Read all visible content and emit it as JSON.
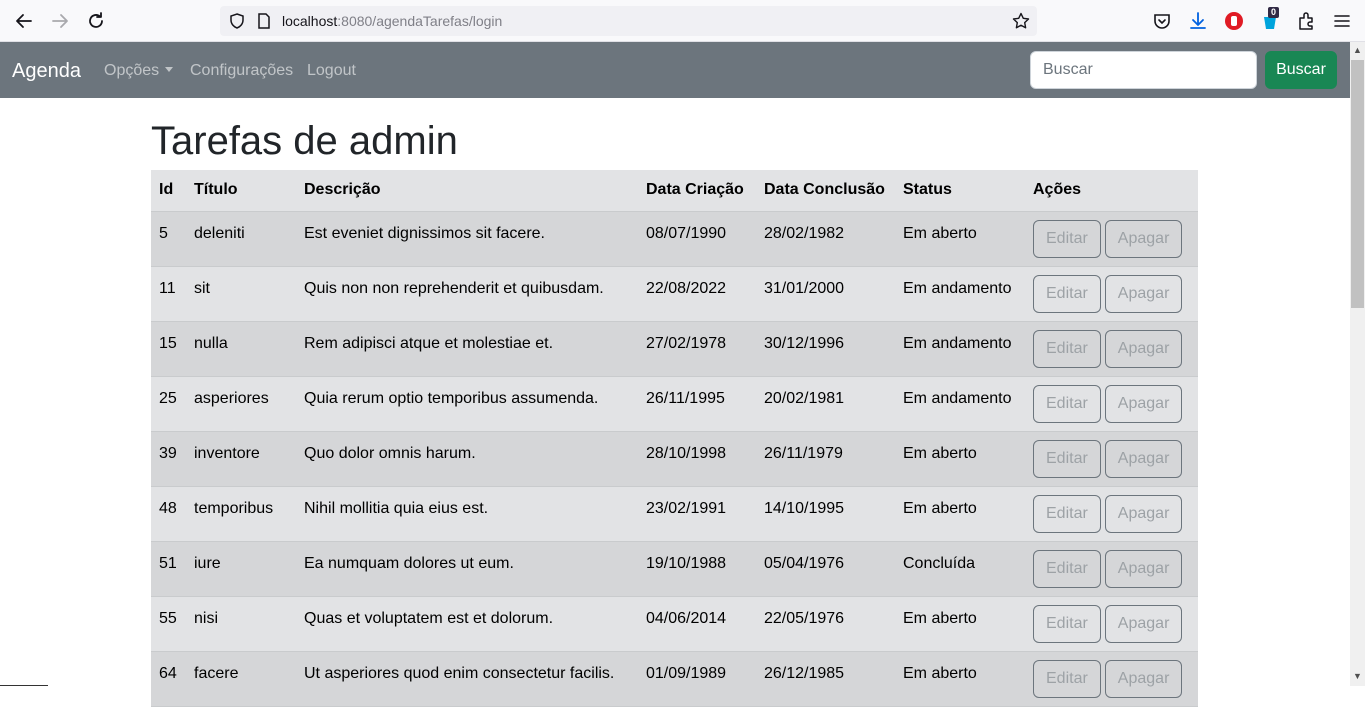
{
  "browser": {
    "url_host": "localhost",
    "url_rest": ":8080/agendaTarefas/login",
    "extension_badge": "0"
  },
  "navbar": {
    "brand": "Agenda",
    "links": [
      "Opções",
      "Configurações",
      "Logout"
    ],
    "search_placeholder": "Buscar",
    "search_button": "Buscar"
  },
  "page": {
    "title": "Tarefas de admin"
  },
  "table": {
    "headers": [
      "Id",
      "Título",
      "Descrição",
      "Data Criação",
      "Data Conclusão",
      "Status",
      "Ações"
    ],
    "edit_label": "Editar",
    "delete_label": "Apagar",
    "rows": [
      {
        "id": "5",
        "titulo": "deleniti",
        "descricao": "Est eveniet dignissimos sit facere.",
        "criacao": "08/07/1990",
        "conclusao": "28/02/1982",
        "status": "Em aberto"
      },
      {
        "id": "11",
        "titulo": "sit",
        "descricao": "Quis non non reprehenderit et quibusdam.",
        "criacao": "22/08/2022",
        "conclusao": "31/01/2000",
        "status": "Em andamento"
      },
      {
        "id": "15",
        "titulo": "nulla",
        "descricao": "Rem adipisci atque et molestiae et.",
        "criacao": "27/02/1978",
        "conclusao": "30/12/1996",
        "status": "Em andamento"
      },
      {
        "id": "25",
        "titulo": "asperiores",
        "descricao": "Quia rerum optio temporibus assumenda.",
        "criacao": "26/11/1995",
        "conclusao": "20/02/1981",
        "status": "Em andamento"
      },
      {
        "id": "39",
        "titulo": "inventore",
        "descricao": "Quo dolor omnis harum.",
        "criacao": "28/10/1998",
        "conclusao": "26/11/1979",
        "status": "Em aberto"
      },
      {
        "id": "48",
        "titulo": "temporibus",
        "descricao": "Nihil mollitia quia eius est.",
        "criacao": "23/02/1991",
        "conclusao": "14/10/1995",
        "status": "Em aberto"
      },
      {
        "id": "51",
        "titulo": "iure",
        "descricao": "Ea numquam dolores ut eum.",
        "criacao": "19/10/1988",
        "conclusao": "05/04/1976",
        "status": "Concluída"
      },
      {
        "id": "55",
        "titulo": "nisi",
        "descricao": "Quas et voluptatem est et dolorum.",
        "criacao": "04/06/2014",
        "conclusao": "22/05/1976",
        "status": "Em aberto"
      },
      {
        "id": "64",
        "titulo": "facere",
        "descricao": "Ut asperiores quod enim consectetur facilis.",
        "criacao": "01/09/1989",
        "conclusao": "26/12/1985",
        "status": "Em aberto"
      }
    ]
  }
}
